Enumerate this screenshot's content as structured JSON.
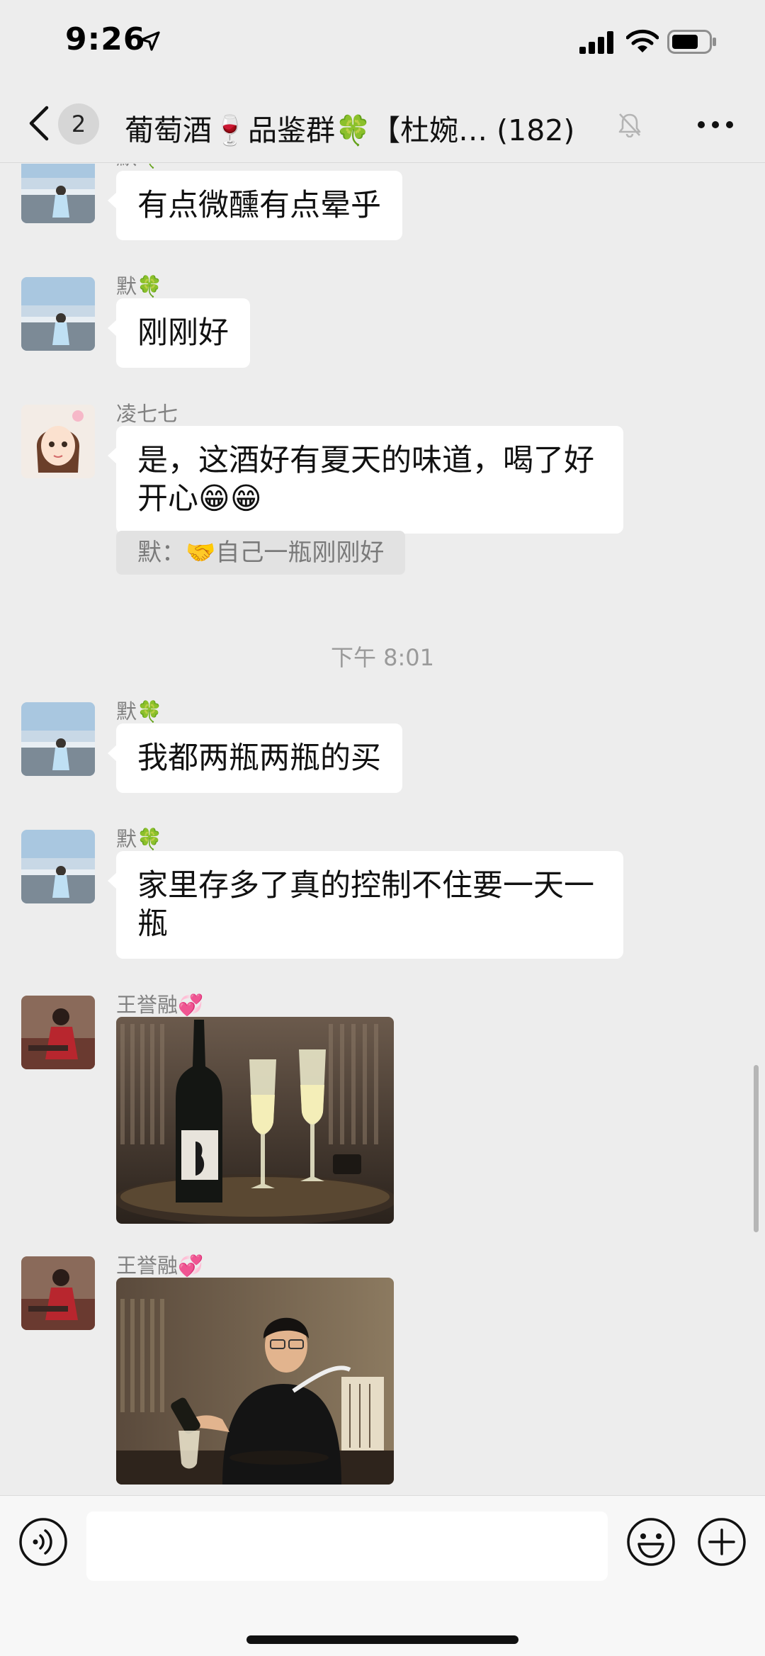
{
  "status_bar": {
    "time": "9:26",
    "icons": [
      "location-arrow-icon",
      "cellular-signal-icon",
      "wifi-icon",
      "battery-icon"
    ]
  },
  "nav": {
    "unread_count": "2",
    "group_title": "葡萄酒🍷品鉴群🍀【杜婉…",
    "member_count": "(182)",
    "icons": [
      "back-chevron-icon",
      "muted-bell-icon",
      "more-icon"
    ]
  },
  "messages": [
    {
      "sender": "默🍀",
      "text": "有点微醺有点晕乎"
    },
    {
      "sender": "默🍀",
      "text": "刚刚好"
    },
    {
      "sender": "凌七七",
      "text_line1": "是，这酒好有夏天的味道，喝了好",
      "text_line2": "开心😁😁",
      "quote_sender": "默：",
      "quote_text": "🤝自己一瓶刚刚好"
    },
    {
      "sender": "默🍀",
      "text": "我都两瓶两瓶的买"
    },
    {
      "sender": "默🍀",
      "text_line1": "家里存多了真的控制不住要一天一",
      "text_line2": "瓶"
    },
    {
      "sender": "王誉融💞",
      "image": "photo-wine-bottle-and-glasses"
    },
    {
      "sender": "王誉融💞",
      "image": "photo-man-pouring-wine"
    }
  ],
  "time_divider": "下午 8:01",
  "input_bar": {
    "icons": [
      "voice-icon",
      "emoji-icon",
      "plus-icon"
    ],
    "placeholder": ""
  },
  "colors": {
    "background": "#ededed",
    "bubble": "#ffffff",
    "quote": "#e2e2e2",
    "secondary_text": "#808080"
  }
}
